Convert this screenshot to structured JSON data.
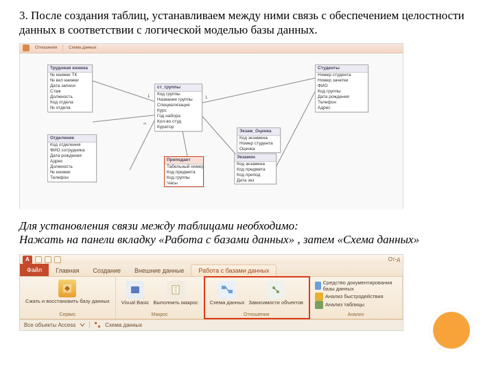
{
  "para_top": "3. После создания таблиц, устанавливаем между ними связь с обеспечением целостности данных в соответствии с логической моделью базы данных.",
  "para_mid_1": "Для установления связи между таблицами необходимо:",
  "para_mid_2": "Нажать на панели вкладку «Работа с базами данных» , затем «Схема данных»",
  "schema": {
    "ribbon": {
      "t1": "Отношения",
      "t2": "Схема данных"
    },
    "tables": {
      "t1": {
        "hdr": "Трудовая книжка",
        "rows": [
          "№ книжки ТК",
          "№ вкл книжки",
          "Дата записи",
          "Стаж",
          "Должность",
          "Код отдела",
          "№ отдела"
        ]
      },
      "t2": {
        "hdr": "Отделение",
        "rows": [
          "Код отделения",
          "ФИО сотрудника",
          "Дата рождения",
          "Адрес",
          "Должность",
          "№ книжки",
          "Телефон"
        ]
      },
      "t3": {
        "hdr": "ст_группы",
        "rows": [
          "Код группы",
          "Название группы",
          "Специализация",
          "Курс",
          "Год набора",
          "Кол-во студ",
          "Куратор"
        ]
      },
      "t4": {
        "hdr": "Преподает",
        "rows": [
          "Табельный номер",
          "Код предмета",
          "Код группы",
          "Часы"
        ]
      },
      "t5": {
        "hdr": "Студенты",
        "rows": [
          "Номер студента",
          "Номер зачетки",
          "ФИО",
          "Код группы",
          "Дата рождения",
          "Телефон",
          "Адрес"
        ]
      },
      "t6": {
        "hdr": "Экзамен",
        "rows": [
          "Код экзамена",
          "Код предмета",
          "Код препод",
          "Дата экз"
        ]
      },
      "t7": {
        "hdr": "Экзам_Оценка",
        "rows": [
          "Код экзамена",
          "Номер студента",
          "Оценка"
        ]
      }
    }
  },
  "ribbon2": {
    "title_right": "От-д",
    "file": "Файл",
    "tabs": [
      "Главная",
      "Создание",
      "Внешние данные",
      "Работа с базами данных"
    ],
    "grp_service": {
      "btn": "Сжать и восстановить базу данных",
      "name": "Сервис"
    },
    "grp_macros": {
      "b1": "Visual Basic",
      "b2": "Выполнить макрос",
      "name": "Макрос"
    },
    "grp_rel": {
      "b1": "Схема данных",
      "b2": "Зависимости объектов",
      "name": "Отношения"
    },
    "grp_analyze": {
      "r1": "Средство документирования базы данных",
      "r2": "Анализ быстродействия",
      "r3": "Анализ таблицы",
      "name": "Анализ"
    },
    "nav": {
      "label": "Все объекты Access",
      "sheet": "Схема данных"
    }
  }
}
